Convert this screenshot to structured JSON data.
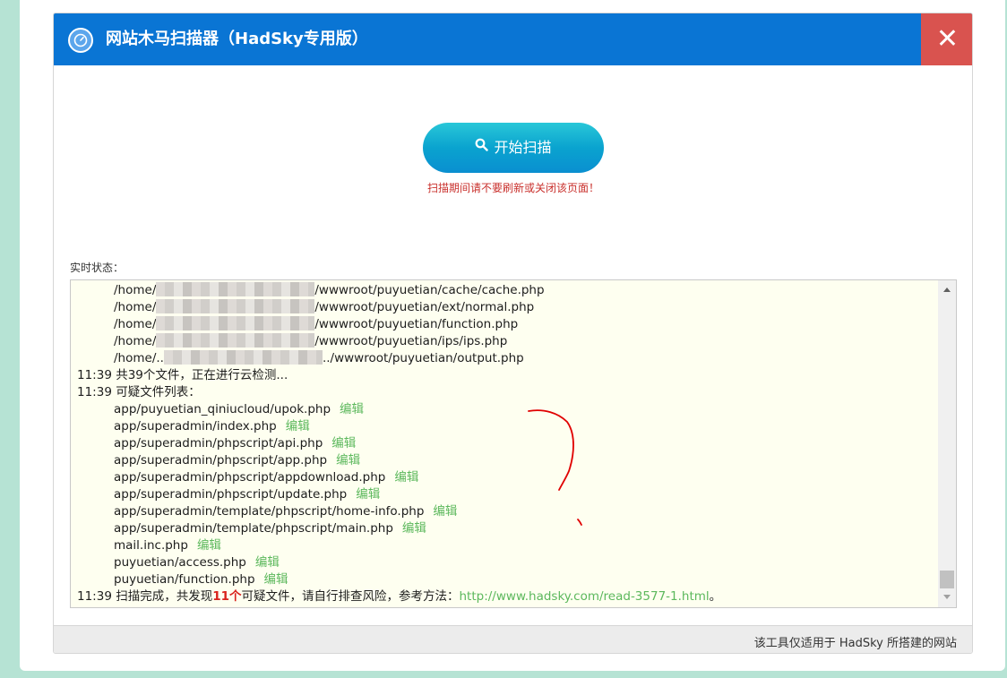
{
  "header": {
    "title": "网站木马扫描器（HadSky专用版）",
    "close_label": "✕"
  },
  "scan": {
    "button_label": "开始扫描",
    "warning": "扫描期间请不要刷新或关闭该页面！"
  },
  "status_label": "实时状态：",
  "log": {
    "checked_paths": [
      {
        "prefix": "/home/",
        "suffix": "/wwwroot/puyuetian/cache/cache.php"
      },
      {
        "prefix": "/home/",
        "suffix": "/wwwroot/puyuetian/ext/normal.php"
      },
      {
        "prefix": "/home/",
        "suffix": "/wwwroot/puyuetian/function.php"
      },
      {
        "prefix": "/home/",
        "suffix": "/wwwroot/puyuetian/ips/ips.php"
      },
      {
        "prefix": "/home/..",
        "suffix": "../wwwroot/puyuetian/output.php"
      }
    ],
    "cloud_line": "11:39 共39个文件，正在进行云检测...",
    "suspicious_header": "11:39 可疑文件列表：",
    "edit_label": "编辑",
    "suspicious_files": [
      "app/puyuetian_qiniucloud/upok.php",
      "app/superadmin/index.php",
      "app/superadmin/phpscript/api.php",
      "app/superadmin/phpscript/app.php",
      "app/superadmin/phpscript/appdownload.php",
      "app/superadmin/phpscript/update.php",
      "app/superadmin/template/phpscript/home-info.php",
      "app/superadmin/template/phpscript/main.php",
      "mail.inc.php",
      "puyuetian/access.php",
      "puyuetian/function.php"
    ],
    "complete_prefix": "11:39 扫描完成，共发现",
    "complete_count": "11个",
    "complete_suffix": "可疑文件，请自行排查风险，参考方法：",
    "help_url": "http://www.hadsky.com/read-3577-1.html",
    "complete_end": "。"
  },
  "footer": {
    "note": "该工具仅适用于 HadSky 所搭建的网站"
  },
  "colors": {
    "header_bg": "#0a75d4",
    "close_bg": "#d9534f",
    "warning_text": "#c9302c",
    "edit_link": "#5cb85c",
    "log_bg": "#fefff0",
    "annotation_stroke": "#e00000"
  },
  "icons": {
    "header": "gauge-icon",
    "scan": "search-icon",
    "close": "close-icon"
  }
}
